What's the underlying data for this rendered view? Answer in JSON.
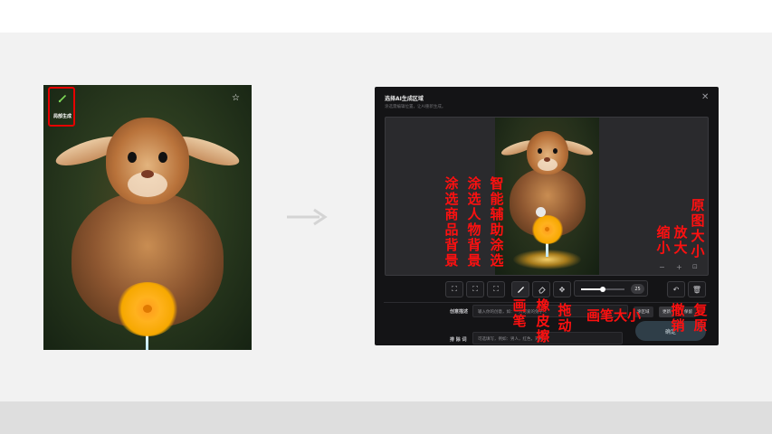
{
  "left_panel": {
    "tool_label": "局部生成"
  },
  "editor": {
    "title": "选择AI生成区域",
    "subtitle": "涂选需编辑位置，让AI重新生成。",
    "brush_size": 25,
    "brush_size_fraction": 0.5,
    "fields": [
      {
        "label": "创意描述",
        "placeholder": "输入你的创意，如：一只可爱的兔子…"
      },
      {
        "label": "排 除 词",
        "placeholder": "可选填写，例如：男人，红色，对称…"
      }
    ],
    "side_buttons": [
      "涂区域",
      "更新",
      "保留"
    ],
    "confirm_label": "确定"
  },
  "annotations": {
    "smart_brush": "智能辅助涂选",
    "select_person_bg": "涂选人物背景",
    "select_product_bg": "涂选商品背景",
    "brush": "画笔",
    "eraser": "橡皮擦",
    "drag": "拖动",
    "brush_size": "画笔大小",
    "zoom_out": "缩小",
    "zoom_in": "放大",
    "original_size": "原图大小",
    "undo": "撤销",
    "restore": "复原"
  },
  "colors": {
    "annotation": "#ff1010",
    "highlight_box": "#e60000",
    "modal_bg": "#141416"
  }
}
